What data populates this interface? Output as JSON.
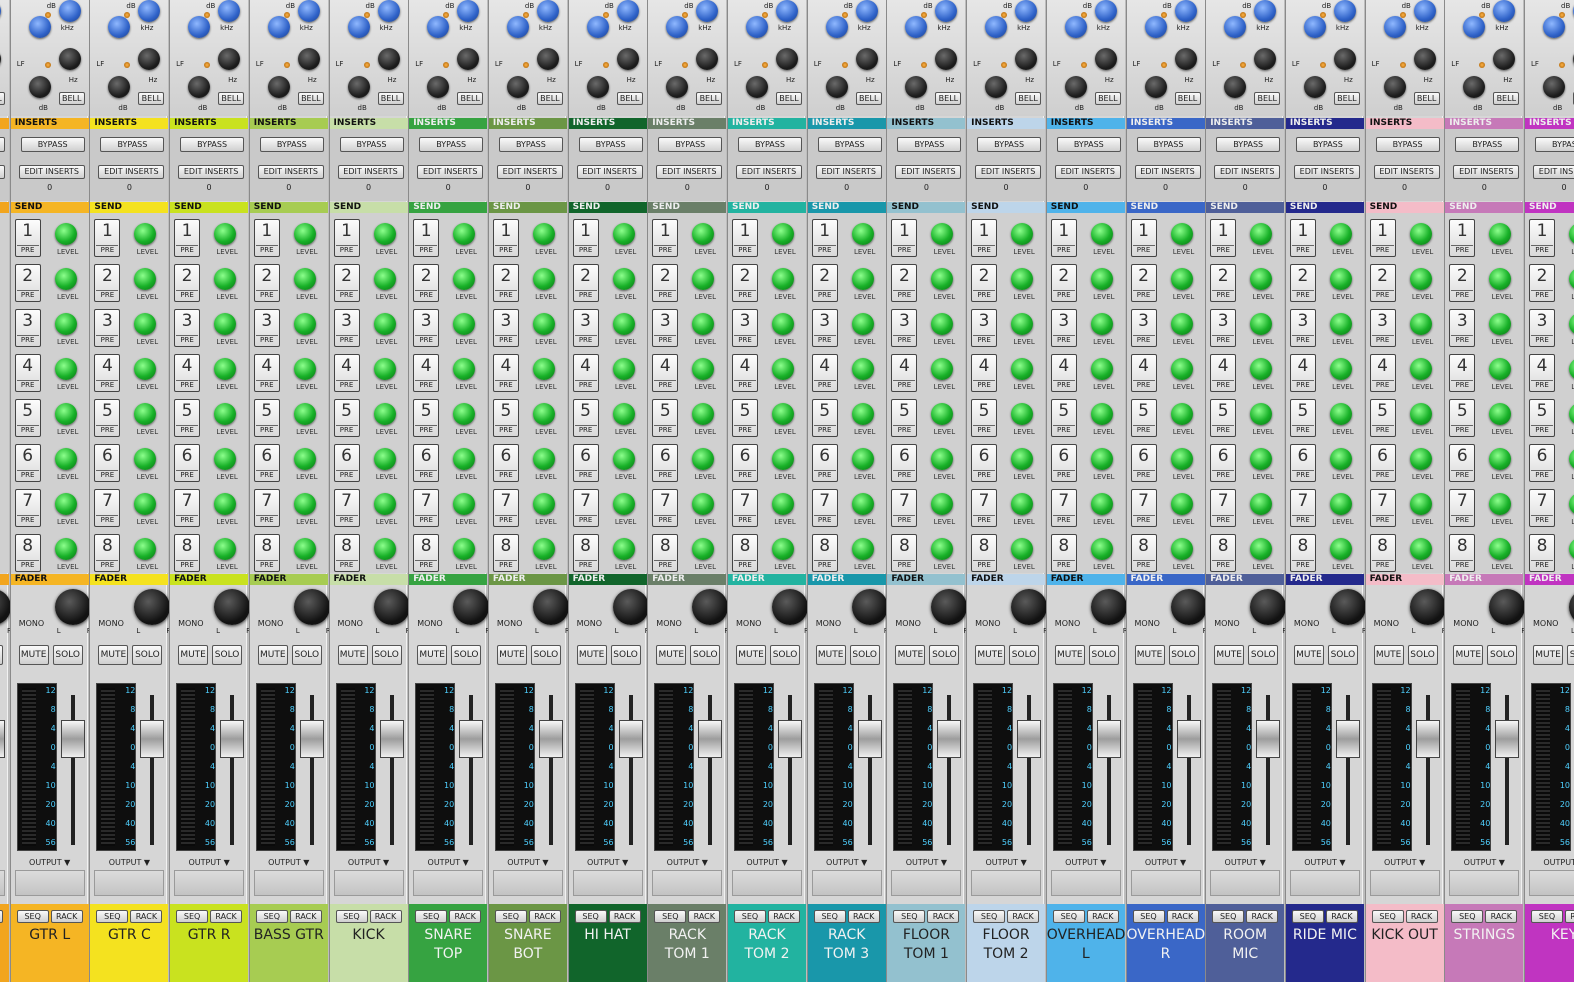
{
  "labels": {
    "db": "dB",
    "khz": "kHz",
    "lf": "LF",
    "hz": "Hz",
    "bell": "BELL",
    "inserts": "INSERTS",
    "bypass": "BYPASS",
    "edit_inserts": "EDIT INSERTS",
    "send": "SEND",
    "pre": "PRE",
    "level": "LEVEL",
    "fader": "FADER",
    "mono": "MONO",
    "l": "L",
    "r": "R",
    "mute": "MUTE",
    "solo": "SOLO",
    "output": "OUTPUT ▼",
    "seq": "SEQ",
    "rack": "RACK"
  },
  "send_numbers": [
    "1",
    "2",
    "3",
    "4",
    "5",
    "6",
    "7",
    "8"
  ],
  "meter_scale": [
    "12",
    "8",
    "4",
    "0",
    "4",
    "10",
    "20",
    "40",
    "56"
  ],
  "channels": [
    {
      "name": "",
      "color": "#f2a51e",
      "inserts_count": "0",
      "dark_text": false
    },
    {
      "name": "GTR L",
      "color": "#f5b524",
      "inserts_count": "0",
      "dark_text": false
    },
    {
      "name": "GTR C",
      "color": "#f4e21f",
      "inserts_count": "0",
      "dark_text": false
    },
    {
      "name": "GTR R",
      "color": "#c9e21f",
      "inserts_count": "0",
      "dark_text": false
    },
    {
      "name": "BASS GTR",
      "color": "#a7cc52",
      "inserts_count": "0",
      "dark_text": false
    },
    {
      "name": "KICK",
      "color": "#c7dea8",
      "inserts_count": "0",
      "dark_text": false
    },
    {
      "name": "SNARE\nTOP",
      "color": "#36a341",
      "inserts_count": "0",
      "dark_text": true
    },
    {
      "name": "SNARE\nBOT",
      "color": "#6b9645",
      "inserts_count": "0",
      "dark_text": true
    },
    {
      "name": "HI HAT",
      "color": "#11652b",
      "inserts_count": "0",
      "dark_text": true
    },
    {
      "name": "RACK\nTOM 1",
      "color": "#6a7f68",
      "inserts_count": "0",
      "dark_text": true
    },
    {
      "name": "RACK\nTOM 2",
      "color": "#22b3a0",
      "inserts_count": "0",
      "dark_text": true
    },
    {
      "name": "RACK\nTOM 3",
      "color": "#1997aa",
      "inserts_count": "0",
      "dark_text": true
    },
    {
      "name": "FLOOR\nTOM 1",
      "color": "#93c1cf",
      "inserts_count": "0",
      "dark_text": false
    },
    {
      "name": "FLOOR\nTOM 2",
      "color": "#bdd5ea",
      "inserts_count": "0",
      "dark_text": false
    },
    {
      "name": "OVERHEAD\nL",
      "color": "#4fb3ea",
      "inserts_count": "0",
      "dark_text": false
    },
    {
      "name": "OVERHEAD\nR",
      "color": "#3a67c7",
      "inserts_count": "0",
      "dark_text": true
    },
    {
      "name": "ROOM\nMIC",
      "color": "#4f5f99",
      "inserts_count": "0",
      "dark_text": true
    },
    {
      "name": "RIDE MIC",
      "color": "#24298c",
      "inserts_count": "0",
      "dark_text": true
    },
    {
      "name": "KICK OUT",
      "color": "#f4bcc8",
      "inserts_count": "0",
      "dark_text": false
    },
    {
      "name": "STRINGS",
      "color": "#c679b8",
      "inserts_count": "0",
      "dark_text": true
    },
    {
      "name": "KEY",
      "color": "#c034c1",
      "inserts_count": "0",
      "dark_text": true
    }
  ]
}
